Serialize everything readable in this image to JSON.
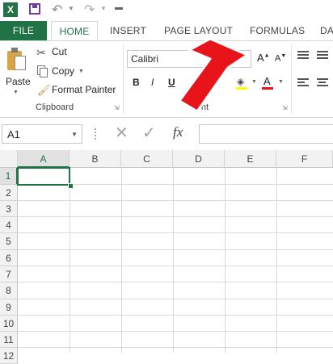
{
  "qat": {
    "app_icon": "excel-icon",
    "save_icon": "save-icon",
    "undo_icon": "undo-icon",
    "redo_icon": "redo-icon",
    "customize_icon": "customize-icon"
  },
  "tabs": [
    {
      "label": "FILE"
    },
    {
      "label": "HOME"
    },
    {
      "label": "INSERT"
    },
    {
      "label": "PAGE LAYOUT"
    },
    {
      "label": "FORMULAS"
    },
    {
      "label": "DA"
    }
  ],
  "clipboard": {
    "paste_label": "Paste",
    "cut_label": "Cut",
    "copy_label": "Copy",
    "format_painter_label": "Format Painter",
    "group_label": "Clipboard"
  },
  "font": {
    "font_name": "Calibri",
    "bold": "B",
    "italic": "I",
    "underline": "U",
    "group_label": "Font"
  },
  "formula_bar": {
    "name_box": "A1",
    "fx": "fx",
    "value": ""
  },
  "grid": {
    "columns": [
      "A",
      "B",
      "C",
      "D",
      "E",
      "F"
    ],
    "rows": [
      "1",
      "2",
      "3",
      "4",
      "5",
      "6",
      "7",
      "8",
      "9",
      "10",
      "11",
      "12"
    ],
    "selected_cell": "A1"
  },
  "colors": {
    "excel_green": "#217346",
    "arrow_red": "#e8141a"
  }
}
